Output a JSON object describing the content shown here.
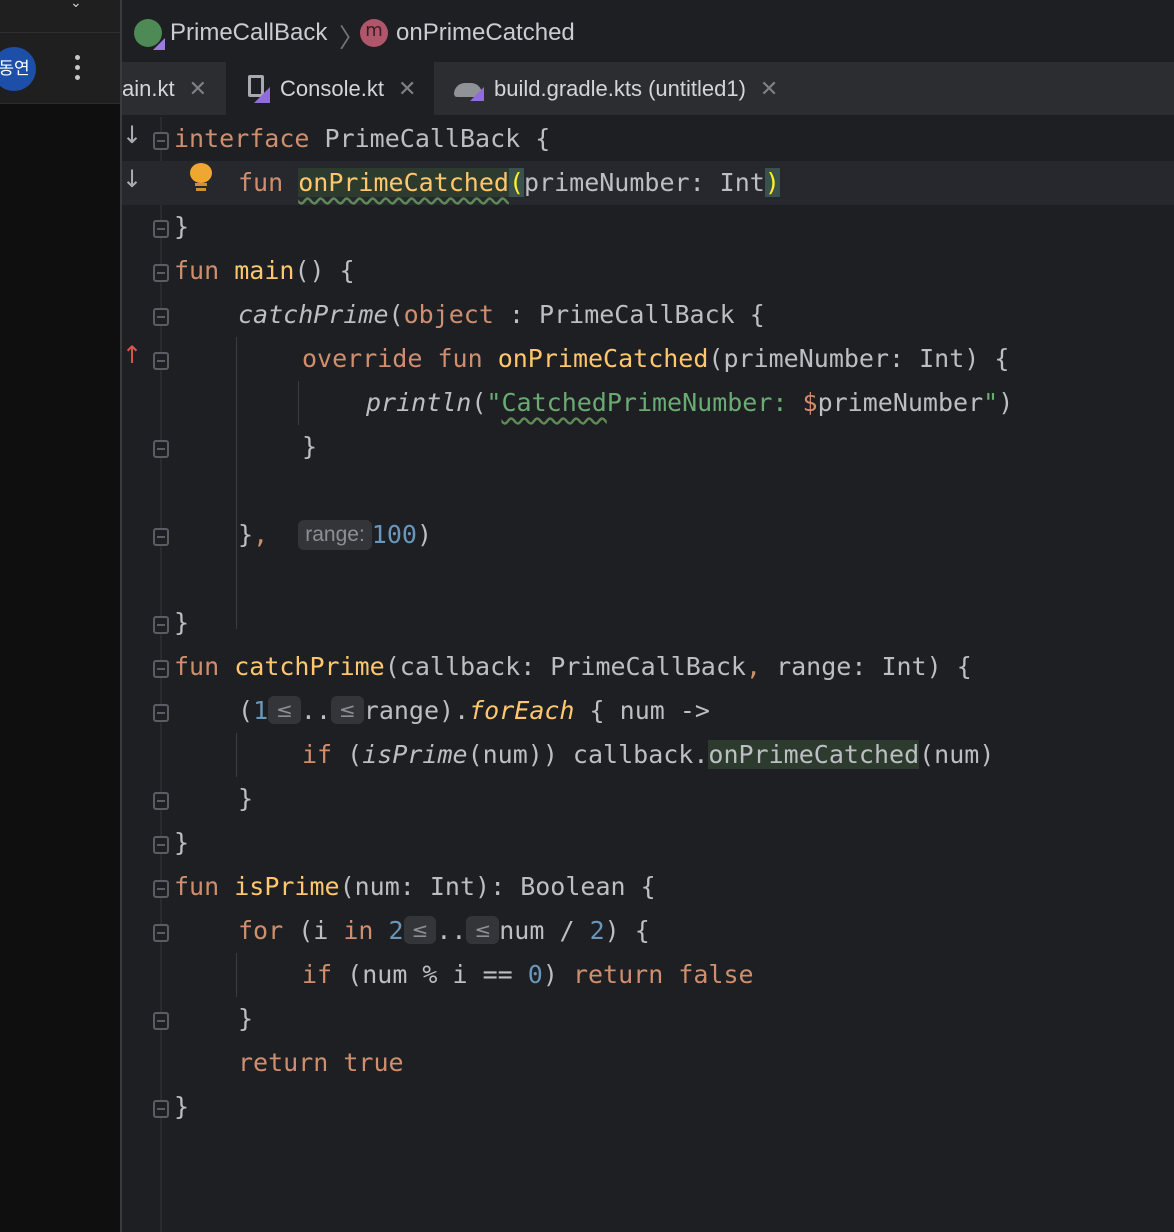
{
  "left_panel": {
    "avatar_text": "동연",
    "menu_icon": "kebab-menu-icon"
  },
  "breadcrumb": {
    "class_name": "PrimeCallBack",
    "method_name": "onPrimeCatched"
  },
  "tabs": [
    {
      "label": "ain.kt",
      "active": false
    },
    {
      "label": "Console.kt",
      "active": true
    },
    {
      "label": "build.gradle.kts (untitled1)",
      "active": false
    }
  ],
  "editor": {
    "inlay_hint_range": "range:",
    "range_value": "100",
    "op_hint": "≤"
  },
  "colors": {
    "keyword": "#cf8e6d",
    "function": "#ffc66d",
    "string": "#6aab73",
    "number": "#6897bb",
    "text": "#bcbec4",
    "background": "#1e1f22"
  }
}
